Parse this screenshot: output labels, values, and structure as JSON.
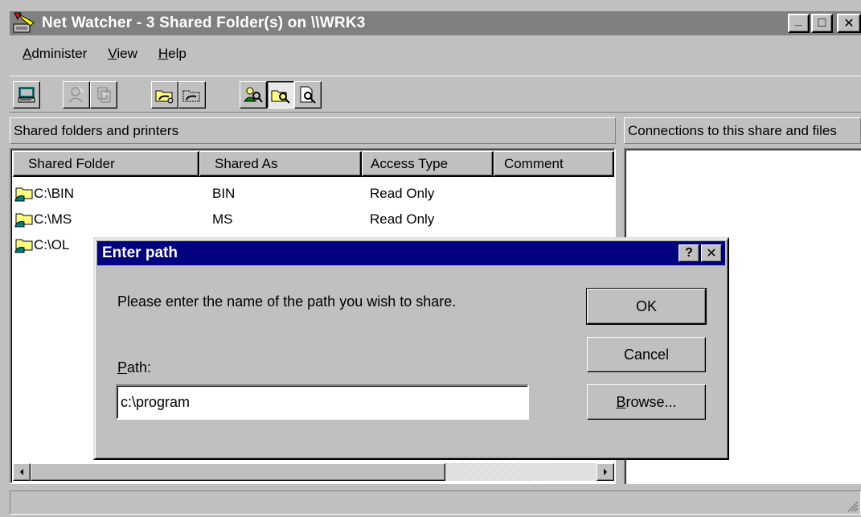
{
  "window": {
    "title": "Net Watcher - 3 Shared Folder(s) on \\\\WRK3",
    "minimize": "_",
    "maximize": "□",
    "close": "✕"
  },
  "menu": [
    {
      "label": "Administer",
      "mnemonic": "A",
      "rest": "dminister"
    },
    {
      "label": "View",
      "mnemonic": "V",
      "rest": "iew"
    },
    {
      "label": "Help",
      "mnemonic": "H",
      "rest": "elp"
    }
  ],
  "toolbar": {
    "buttons": [
      {
        "name": "select-server-icon",
        "state": "normal"
      },
      {
        "name": "disconnect-user-icon",
        "state": "disabled"
      },
      {
        "name": "close-file-icon",
        "state": "disabled"
      },
      {
        "name": "add-shared-folder-icon",
        "state": "normal"
      },
      {
        "name": "stop-sharing-icon",
        "state": "normal"
      },
      {
        "name": "show-users-icon",
        "state": "normal"
      },
      {
        "name": "show-shared-folders-icon",
        "state": "pressed"
      },
      {
        "name": "show-files-icon",
        "state": "normal"
      }
    ]
  },
  "left_pane": {
    "header": "Shared folders and printers",
    "columns": [
      "Shared Folder",
      "Shared As",
      "Access Type",
      "Comment"
    ],
    "rows": [
      {
        "folder": "C:\\BIN",
        "shared_as": "BIN",
        "access": "Read Only",
        "comment": ""
      },
      {
        "folder": "C:\\MS",
        "shared_as": "MS",
        "access": "Read Only",
        "comment": ""
      },
      {
        "folder": "C:\\OL",
        "shared_as": "",
        "access": "",
        "comment": ""
      }
    ]
  },
  "right_pane": {
    "header": "Connections to this share and files"
  },
  "dialog": {
    "title": "Enter path",
    "help_button": "?",
    "close_button": "✕",
    "prompt": "Please enter the name of the path you wish to share.",
    "path_label_mnemonic": "P",
    "path_label_rest": "ath:",
    "path_value": "c:\\program",
    "ok_label": "OK",
    "cancel_label": "Cancel",
    "browse_mnemonic": "B",
    "browse_rest": "rowse..."
  },
  "colors": {
    "face": "#c0c0c0",
    "active_title": "#000080",
    "inactive_title": "#808080"
  }
}
